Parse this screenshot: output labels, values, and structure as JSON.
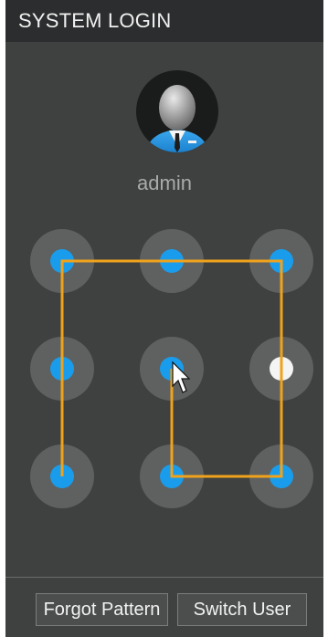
{
  "window": {
    "title": "SYSTEM LOGIN"
  },
  "user": {
    "name": "admin",
    "avatar_icon": "person-avatar-icon"
  },
  "pattern": {
    "grid": 3,
    "selected_sequence": [
      7,
      4,
      1,
      2,
      3,
      6,
      9,
      8,
      5
    ],
    "highlighted_dot": 6,
    "colors": {
      "line": "#f0a21b",
      "dot": "#1a9cec",
      "highlight": "#f4f4f4"
    }
  },
  "footer": {
    "forgot_label": "Forgot Pattern",
    "switch_label": "Switch User"
  },
  "colors": {
    "background": "#3e4140",
    "titlebar": "#2c2d2e"
  }
}
